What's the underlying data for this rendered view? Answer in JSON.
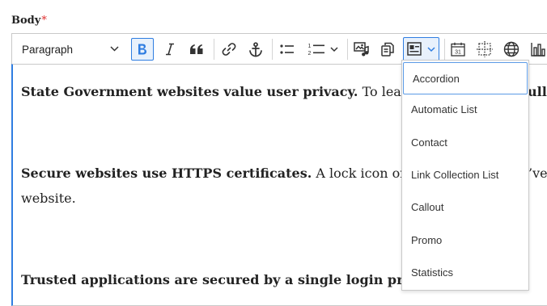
{
  "field": {
    "label": "Body",
    "required_mark": "*"
  },
  "toolbar": {
    "heading_select": "Paragraph",
    "buttons": [
      "bold",
      "italic",
      "blockquote",
      "link",
      "anchor",
      "bulleted-list",
      "numbered-list",
      "media",
      "copy",
      "templates",
      "calendar",
      "grid",
      "globe",
      "chart"
    ],
    "calendar_day": "31",
    "accent": "#2f7de1"
  },
  "editor": {
    "paragraphs": [
      {
        "strong": "State Government websites value user privacy.",
        "rest": " To lear",
        "tail": "ull"
      },
      {
        "strong": "Secure websites use HTTPS certificates.",
        "rest": " A lock icon or",
        "tail": "’ve",
        "cont": "website."
      },
      {
        "strong": "Trusted applications are secured by a single login pro",
        "rest": ""
      }
    ]
  },
  "templates_menu": {
    "items": [
      "Accordion",
      "Automatic List",
      "Contact",
      "Link Collection List",
      "Callout",
      "Promo",
      "Statistics"
    ],
    "focused": "Accordion"
  }
}
